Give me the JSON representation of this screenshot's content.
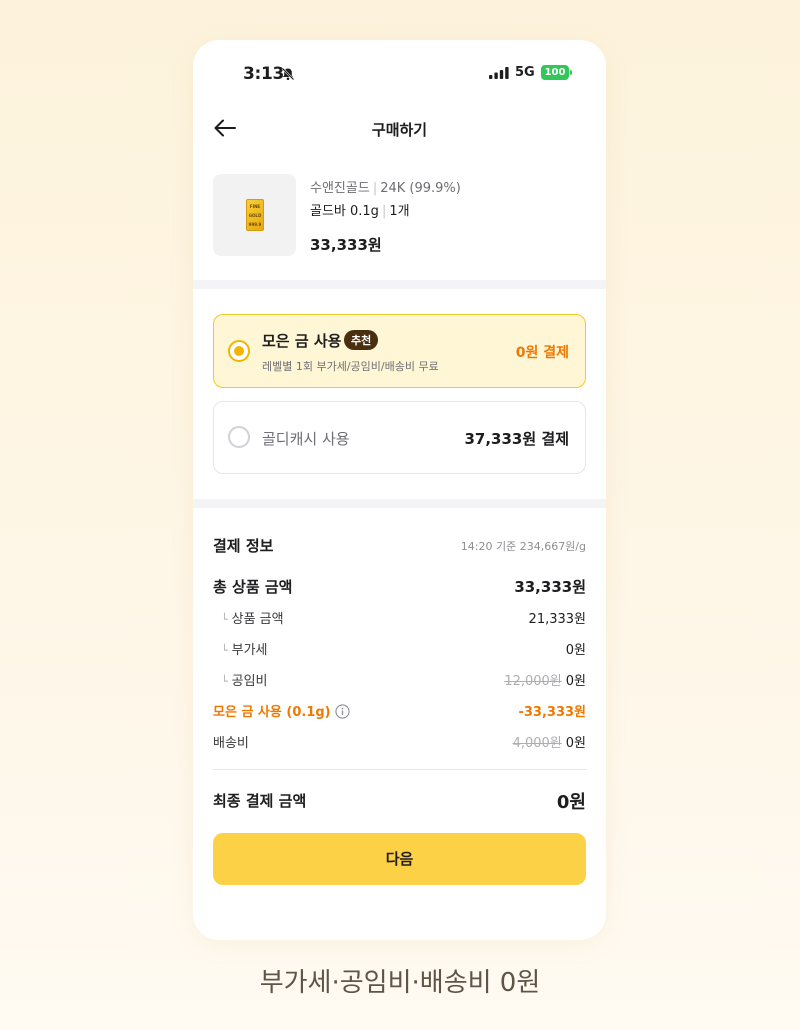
{
  "status_bar": {
    "time": "3:13",
    "network": "5G",
    "battery": "100"
  },
  "header": {
    "title": "구매하기"
  },
  "product": {
    "brand": "수앤진골드",
    "purity": "24K (99.9%)",
    "name": "골드바 0.1g",
    "quantity": "1개",
    "price": "33,333원",
    "bar_text": [
      "FINE",
      "GOLD",
      "999.9"
    ]
  },
  "options": [
    {
      "label": "모은 금 사용",
      "badge": "추천",
      "description": "레벨별 1회 부가세/공임비/배송비 무료",
      "amount": "0원 결제",
      "selected": true
    },
    {
      "label": "골디캐시 사용",
      "amount": "37,333원 결제",
      "selected": false
    }
  ],
  "payment_info": {
    "title": "결제 정보",
    "rate": "14:20 기준 234,667원/g",
    "total_label": "총 상품 금액",
    "total_value": "33,333원",
    "items": [
      {
        "label": "상품 금액",
        "value": "21,333원"
      },
      {
        "label": "부가세",
        "value": "0원"
      },
      {
        "label": "공임비",
        "original": "12,000원",
        "value": "0원"
      }
    ],
    "gold_use_label": "모은 금 사용 (0.1g)",
    "gold_use_value": "-33,333원",
    "shipping_label": "배송비",
    "shipping_original": "4,000원",
    "shipping_value": "0원",
    "final_label": "최종 결제 금액",
    "final_value": "0원"
  },
  "next_button": "다음",
  "caption": "부가세·공임비·배송비 0원",
  "colors": {
    "accent": "#fdd146",
    "orange": "#f07800",
    "badge": "#4a2e10",
    "battery": "#33c759"
  }
}
